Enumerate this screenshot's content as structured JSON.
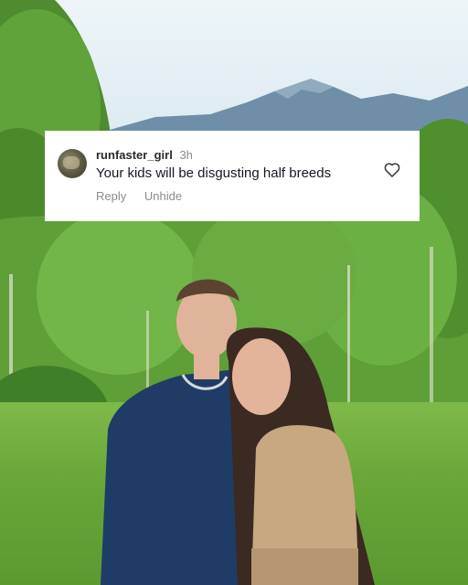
{
  "comment": {
    "username": "runfaster_girl",
    "time_ago": "3h",
    "text": "Your kids will be disgusting half breeds",
    "actions": {
      "reply": "Reply",
      "unhide": "Unhide"
    },
    "like_icon": "heart-outline-icon"
  }
}
